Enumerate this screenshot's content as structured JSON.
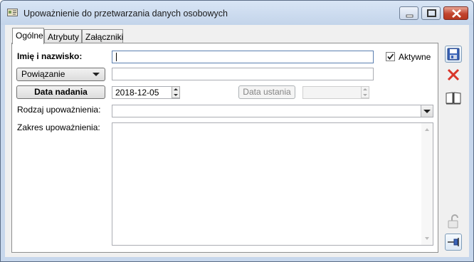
{
  "window": {
    "title": "Upoważnienie do przetwarzania danych osobowych",
    "accent": "#c7d7ec",
    "close_color": "#c2452f"
  },
  "tabs": [
    {
      "label": "Ogólne",
      "active": true
    },
    {
      "label": "Atrybuty",
      "active": false
    },
    {
      "label": "Załączniki",
      "active": false
    }
  ],
  "form": {
    "name_label": "Imię i nazwisko:",
    "name_value": "",
    "active_label": "Aktywne",
    "active_checked": true,
    "link_dropdown_label": "Powiązanie",
    "link_value": "",
    "grant_date_button": "Data nadania",
    "grant_date_value": "2018-12-05",
    "expiry_date_button": "Data ustania",
    "expiry_date_value": "",
    "type_label": "Rodzaj upoważnienia:",
    "type_value": "",
    "scope_label": "Zakres upoważnienia:",
    "scope_value": ""
  },
  "side_toolbar": {
    "icons": [
      "save-icon",
      "delete-icon",
      "book-icon",
      "lock-icon",
      "pin-icon"
    ]
  }
}
